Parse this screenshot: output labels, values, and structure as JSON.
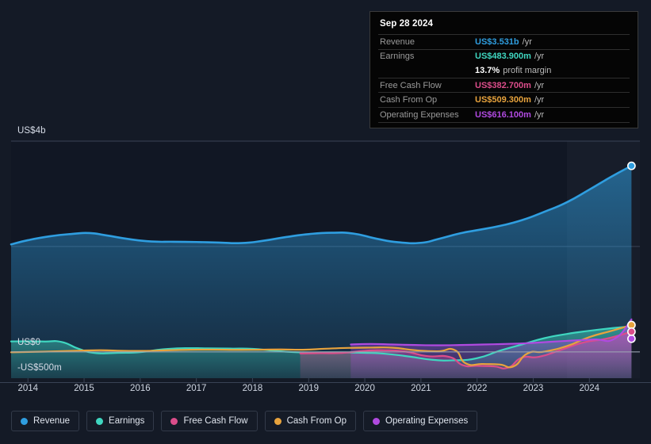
{
  "axes": {
    "y_top_label": "US$4b",
    "y_zero_label": "US$0",
    "y_neg_label": "-US$500m",
    "x_ticks": [
      "2014",
      "2015",
      "2016",
      "2017",
      "2018",
      "2019",
      "2020",
      "2021",
      "2022",
      "2023",
      "2024"
    ]
  },
  "tooltip": {
    "date": "Sep 28 2024",
    "rows": [
      {
        "label": "Revenue",
        "value": "US$3.531b",
        "unit": "/yr",
        "color": "#2f9ee0"
      },
      {
        "label": "Earnings",
        "value": "US$483.900m",
        "unit": "/yr",
        "color": "#3fd6c0"
      },
      {
        "label": "Free Cash Flow",
        "value": "US$382.700m",
        "unit": "/yr",
        "color": "#db4d8a"
      },
      {
        "label": "Cash From Op",
        "value": "US$509.300m",
        "unit": "/yr",
        "color": "#e8a33d"
      },
      {
        "label": "Operating Expenses",
        "value": "US$616.100m",
        "unit": "/yr",
        "color": "#b04ae0"
      }
    ],
    "margin_value": "13.7%",
    "margin_text": "profit margin"
  },
  "legend": [
    {
      "label": "Revenue",
      "color": "#2f9ee0"
    },
    {
      "label": "Earnings",
      "color": "#3fd6c0"
    },
    {
      "label": "Free Cash Flow",
      "color": "#db4d8a"
    },
    {
      "label": "Cash From Op",
      "color": "#e8a33d"
    },
    {
      "label": "Operating Expenses",
      "color": "#b04ae0"
    }
  ],
  "chart_data": {
    "type": "area",
    "title": "",
    "xlabel": "",
    "ylabel": "",
    "grid": true,
    "legend_position": "bottom",
    "xlim": [
      2013.7,
      2024.9
    ],
    "ylim": [
      -500,
      4000
    ],
    "y_unit": "USD millions",
    "y_ticks": [
      4000,
      2000,
      0,
      -500
    ],
    "y_tick_labels": [
      "US$4b",
      "",
      "US$0",
      "-US$500m"
    ],
    "x_tick_values": [
      2014,
      2015,
      2016,
      2017,
      2018,
      2019,
      2020,
      2021,
      2022,
      2023,
      2024
    ],
    "forecast_band_start": 2023.6,
    "series": [
      {
        "name": "Revenue",
        "color": "#2f9ee0",
        "fill": true,
        "x": [
          2013.7,
          2014.0,
          2014.4,
          2014.8,
          2015.1,
          2015.4,
          2015.8,
          2016.2,
          2016.6,
          2017.0,
          2017.4,
          2017.8,
          2018.2,
          2018.6,
          2019.0,
          2019.4,
          2019.8,
          2020.2,
          2020.6,
          2021.0,
          2021.3,
          2021.7,
          2022.0,
          2022.4,
          2022.8,
          2023.2,
          2023.6,
          2024.0,
          2024.4,
          2024.75
        ],
        "y": [
          2040,
          2120,
          2195,
          2240,
          2255,
          2210,
          2140,
          2095,
          2090,
          2085,
          2075,
          2065,
          2110,
          2180,
          2235,
          2260,
          2245,
          2150,
          2080,
          2070,
          2140,
          2250,
          2310,
          2390,
          2500,
          2660,
          2840,
          3080,
          3330,
          3531
        ]
      },
      {
        "name": "Earnings",
        "color": "#3fd6c0",
        "fill": true,
        "x": [
          2013.7,
          2014.0,
          2014.3,
          2014.6,
          2014.9,
          2015.2,
          2015.6,
          2016.0,
          2016.4,
          2016.8,
          2017.2,
          2017.6,
          2018.0,
          2018.4,
          2018.8,
          2019.2,
          2019.6,
          2020.0,
          2020.4,
          2020.8,
          2021.2,
          2021.6,
          2022.0,
          2022.4,
          2022.8,
          2023.2,
          2023.6,
          2024.0,
          2024.4,
          2024.75
        ],
        "y": [
          198,
          200,
          196,
          188,
          60,
          -22,
          -18,
          -5,
          48,
          70,
          66,
          62,
          58,
          20,
          -8,
          -14,
          -12,
          -18,
          -40,
          -90,
          -150,
          -160,
          -120,
          20,
          140,
          260,
          340,
          400,
          450,
          484
        ]
      },
      {
        "name": "Free Cash Flow",
        "color": "#db4d8a",
        "fill": true,
        "x": [
          2018.85,
          2019.2,
          2019.6,
          2020.0,
          2020.3,
          2020.7,
          2021.1,
          2021.5,
          2021.75,
          2022.0,
          2022.3,
          2022.55,
          2022.8,
          2023.1,
          2023.5,
          2023.9,
          2024.3,
          2024.75
        ],
        "y": [
          -30,
          -25,
          -20,
          20,
          30,
          10,
          -80,
          -95,
          -255,
          -265,
          -275,
          -300,
          -110,
          -95,
          40,
          180,
          250,
          383
        ]
      },
      {
        "name": "Cash From Op",
        "color": "#e8a33d",
        "fill": false,
        "x": [
          2013.7,
          2014.1,
          2014.5,
          2014.9,
          2015.3,
          2015.7,
          2016.1,
          2016.5,
          2016.9,
          2017.3,
          2017.7,
          2018.1,
          2018.5,
          2018.9,
          2019.3,
          2019.7,
          2020.1,
          2020.5,
          2020.9,
          2021.3,
          2021.6,
          2021.8,
          2022.1,
          2022.4,
          2022.65,
          2022.9,
          2023.2,
          2023.6,
          2024.0,
          2024.4,
          2024.75
        ],
        "y": [
          -8,
          0,
          10,
          22,
          30,
          20,
          18,
          30,
          40,
          42,
          38,
          40,
          46,
          40,
          60,
          75,
          80,
          78,
          30,
          10,
          35,
          -220,
          -230,
          -240,
          -275,
          -30,
          5,
          110,
          280,
          400,
          509
        ]
      },
      {
        "name": "Operating Expenses",
        "color": "#b04ae0",
        "fill": true,
        "x": [
          2019.75,
          2020.1,
          2020.5,
          2020.9,
          2021.3,
          2021.7,
          2022.1,
          2022.5,
          2022.9,
          2023.3,
          2023.7,
          2024.1,
          2024.45,
          2024.75
        ],
        "y": [
          140,
          150,
          140,
          130,
          125,
          130,
          140,
          150,
          165,
          190,
          215,
          235,
          250,
          616
        ]
      }
    ],
    "endpoint_markers": [
      {
        "series": "Revenue",
        "x": 2024.75,
        "y": 3531
      },
      {
        "series": "Operating Expenses",
        "x": 2024.75,
        "y": 616
      },
      {
        "series": "Cash From Op",
        "x": 2024.75,
        "y": 509
      },
      {
        "series": "Free Cash Flow",
        "x": 2024.75,
        "y": 383
      }
    ]
  }
}
